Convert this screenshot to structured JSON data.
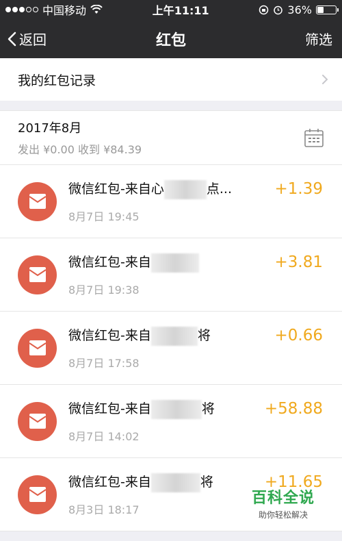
{
  "status_bar": {
    "carrier": "中国移动",
    "time": "上午11:11",
    "battery": "36%",
    "battery_level": 0.36
  },
  "nav": {
    "back_label": "返回",
    "title": "红包",
    "filter_label": "筛选"
  },
  "record_link": {
    "label": "我的红包记录"
  },
  "month": {
    "title": "2017年8月",
    "summary": "发出 ¥0.00 收到 ¥84.39"
  },
  "items": [
    {
      "title_prefix": "微信红包-来自心",
      "title_suffix": "点...",
      "time": "8月7日 19:45",
      "amount": "+1.39"
    },
    {
      "title_prefix": "微信红包-来自",
      "title_suffix": "",
      "time": "8月7日 19:38",
      "amount": "+3.81"
    },
    {
      "title_prefix": "微信红包-来自",
      "title_suffix": "将",
      "time": "8月7日 17:58",
      "amount": "+0.66"
    },
    {
      "title_prefix": "微信红包-来自",
      "title_suffix": "将",
      "time": "8月7日 14:02",
      "amount": "+58.88"
    },
    {
      "title_prefix": "微信红包-来自",
      "title_suffix": "将",
      "time": "8月3日 18:17",
      "amount": "+11.65"
    }
  ],
  "watermark": {
    "title": "百科全说",
    "subtitle": "助你轻松解决"
  },
  "colors": {
    "accent_amount": "#f0a91e",
    "envelope": "#e0604b",
    "nav_bg": "#2c2c2e"
  }
}
